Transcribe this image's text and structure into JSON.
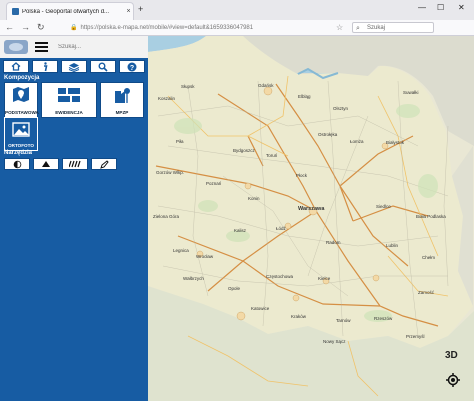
{
  "browser": {
    "tab_title": "Polska - Geoportal otwartych d...",
    "tab_close": "×",
    "new_tab": "+",
    "url": "https://polska.e-mapa.net/mobile/#view=default&1659336047981",
    "search_placeholder": "Szukaj",
    "window_controls": [
      "—",
      "☐",
      "✕"
    ]
  },
  "panel": {
    "search_placeholder": "Szukaj...",
    "section_composition": "Kompozycja",
    "section_tools": "Narzędzia",
    "compositions": [
      {
        "label": "PODSTAWOWA",
        "icon": "map-marker-icon",
        "active": false
      },
      {
        "label": "EWIDENCJA",
        "icon": "parcels-icon",
        "active": false
      },
      {
        "label": "MPZP",
        "icon": "zoning-plan-icon",
        "active": false
      },
      {
        "label": "ORTOFOTO",
        "icon": "photo-icon",
        "active": true
      }
    ]
  },
  "map": {
    "button_3d": "3D",
    "labels": {
      "gdansk": "Gdańsk",
      "olsztyn": "Olsztyn",
      "bialystok": "Białystok",
      "bydgoszcz": "Bydgoszcz",
      "torun": "Toruń",
      "poznan": "Poznań",
      "warszawa": "Warszawa",
      "lodz": "Łódź",
      "lublin": "Lublin",
      "wroclaw": "Wrocław",
      "kielce": "Kielce",
      "katowice": "Katowice",
      "krakow": "Kraków",
      "rzeszow": "Rzeszów",
      "opole": "Opole",
      "radom": "Radom",
      "plock": "Płock",
      "koszalin": "Koszalin",
      "slupsk": "Słupsk",
      "gorzow": "Gorzów Wlkp.",
      "zielona": "Zielona Góra",
      "czestochowa": "Częstochowa",
      "elblag": "Elbląg",
      "suwalki": "Suwałki",
      "siedlce": "Siedlce",
      "kalisz": "Kalisz",
      "tarnow": "Tarnów",
      "przemysl": "Przemyśl",
      "zamosc": "Zamość",
      "legnica": "Legnica",
      "walbrzych": "Wałbrzych",
      "konin": "Konin",
      "lomza": "Łomża",
      "ostroleka": "Ostrołęka",
      "nowy_sacz": "Nowy Sącz",
      "chelm": "Chełm",
      "pila": "Piła",
      "biala_podlaska": "Biała Podlaska"
    }
  }
}
